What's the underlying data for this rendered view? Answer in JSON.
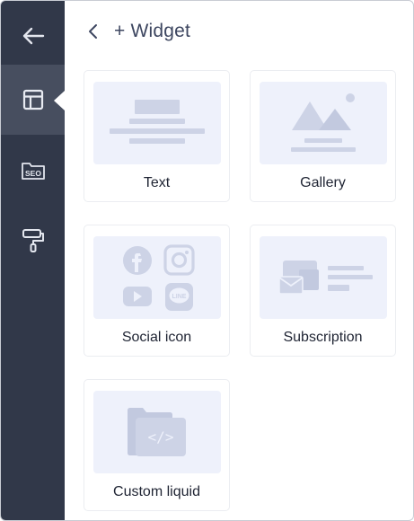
{
  "app": {
    "title": "+ Widget"
  },
  "rail": {
    "items": [
      {
        "icon": "arrow-left-icon",
        "active": false
      },
      {
        "icon": "layout-icon",
        "active": true
      },
      {
        "icon": "seo-folder-icon",
        "label": "SEO",
        "active": false
      },
      {
        "icon": "paint-roller-icon",
        "active": false
      }
    ]
  },
  "widgets": [
    {
      "label": "Text",
      "icon": "text-block-illustration"
    },
    {
      "label": "Gallery",
      "icon": "image-mountain-illustration"
    },
    {
      "label": "Social icon",
      "icon": "social-icons-illustration",
      "mini": {
        "line": "LINE"
      }
    },
    {
      "label": "Subscription",
      "icon": "envelope-form-illustration"
    },
    {
      "label": "Custom liquid",
      "icon": "code-file-illustration",
      "code": "</>"
    }
  ],
  "colors": {
    "rail": "#313849",
    "rail_active": "#474e5f",
    "thumb_bg": "#eef1fb",
    "illustration": "#cdd3e6"
  }
}
